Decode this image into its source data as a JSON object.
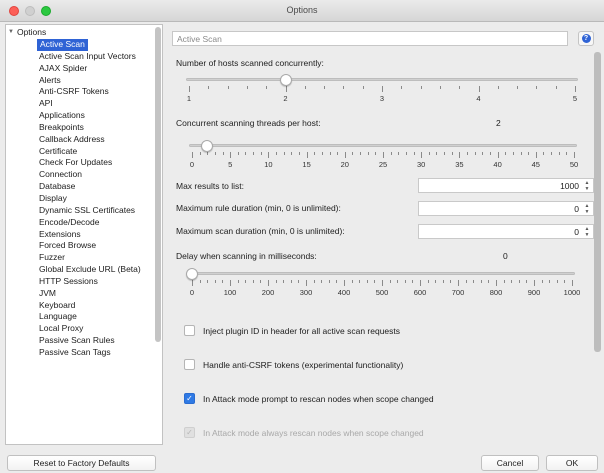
{
  "window": {
    "title": "Options"
  },
  "tree": {
    "root_label": "Options",
    "items": [
      {
        "label": "Active Scan",
        "selected": true
      },
      {
        "label": "Active Scan Input Vectors"
      },
      {
        "label": "AJAX Spider"
      },
      {
        "label": "Alerts"
      },
      {
        "label": "Anti-CSRF Tokens"
      },
      {
        "label": "API"
      },
      {
        "label": "Applications"
      },
      {
        "label": "Breakpoints"
      },
      {
        "label": "Callback Address"
      },
      {
        "label": "Certificate"
      },
      {
        "label": "Check For Updates"
      },
      {
        "label": "Connection"
      },
      {
        "label": "Database"
      },
      {
        "label": "Display"
      },
      {
        "label": "Dynamic SSL Certificates"
      },
      {
        "label": "Encode/Decode"
      },
      {
        "label": "Extensions"
      },
      {
        "label": "Forced Browse"
      },
      {
        "label": "Fuzzer"
      },
      {
        "label": "Global Exclude URL (Beta)"
      },
      {
        "label": "HTTP Sessions"
      },
      {
        "label": "JVM"
      },
      {
        "label": "Keyboard"
      },
      {
        "label": "Language"
      },
      {
        "label": "Local Proxy"
      },
      {
        "label": "Passive Scan Rules"
      },
      {
        "label": "Passive Scan Tags"
      }
    ]
  },
  "panel": {
    "title": "Active Scan",
    "hosts": {
      "label": "Number of hosts scanned concurrently:",
      "value": 2,
      "min": 1,
      "max": 5,
      "ticks": [
        "1",
        "2",
        "3",
        "4",
        "5"
      ]
    },
    "threads": {
      "label": "Concurrent scanning threads per host:",
      "value_text": "2",
      "value": 2,
      "min": 0,
      "max": 50,
      "ticks": [
        "0",
        "5",
        "10",
        "15",
        "20",
        "25",
        "30",
        "35",
        "40",
        "45",
        "50"
      ]
    },
    "max_results": {
      "label": "Max results to list:",
      "value": "1000"
    },
    "max_rule_duration": {
      "label": "Maximum rule duration (min, 0 is unlimited):",
      "value": "0"
    },
    "max_scan_duration": {
      "label": "Maximum scan duration (min, 0 is unlimited):",
      "value": "0"
    },
    "delay": {
      "label": "Delay when scanning in milliseconds:",
      "value_text": "0",
      "value": 0,
      "min": 0,
      "max": 1000,
      "ticks": [
        "0",
        "100",
        "200",
        "300",
        "400",
        "500",
        "600",
        "700",
        "800",
        "900",
        "1000"
      ]
    },
    "inject_plugin_id": {
      "label": "Inject plugin ID in header for all active scan requests",
      "checked": false
    },
    "handle_anticsrf": {
      "label": "Handle anti-CSRF tokens (experimental functionality)",
      "checked": false
    },
    "attack_prompt": {
      "label": "In Attack mode prompt to rescan nodes when scope changed",
      "checked": true
    },
    "attack_always": {
      "label": "In Attack mode always rescan nodes when scope changed",
      "checked": true,
      "disabled": true
    }
  },
  "buttons": {
    "reset": "Reset to Factory Defaults",
    "cancel": "Cancel",
    "ok": "OK"
  },
  "icons": {
    "help": "help-icon",
    "check": "✓"
  }
}
